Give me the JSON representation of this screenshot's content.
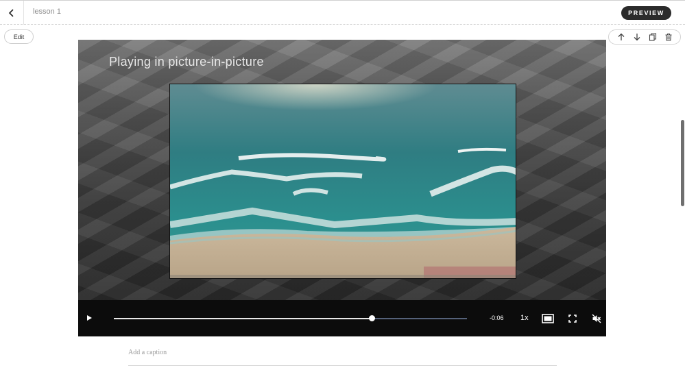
{
  "header": {
    "back_icon": "chevron-left-icon",
    "lesson_title": "lesson 1",
    "preview_label": "PREVIEW"
  },
  "block": {
    "edit_label": "Edit",
    "tools": [
      "arrow-up-icon",
      "arrow-down-icon",
      "duplicate-icon",
      "trash-icon"
    ]
  },
  "video": {
    "pip_message": "Playing in picture-in-picture",
    "progress": 0.73,
    "time_remaining": "-0:06",
    "speed": "1x",
    "icons": [
      "play-icon",
      "picture-in-picture-icon",
      "fullscreen-icon",
      "mute-icon"
    ]
  },
  "caption": {
    "placeholder": "Add a caption"
  },
  "colors": {
    "preview_button": "#2b2b2b",
    "player_bar": "#0c0c0c",
    "track_unplayed": "#55627a"
  }
}
